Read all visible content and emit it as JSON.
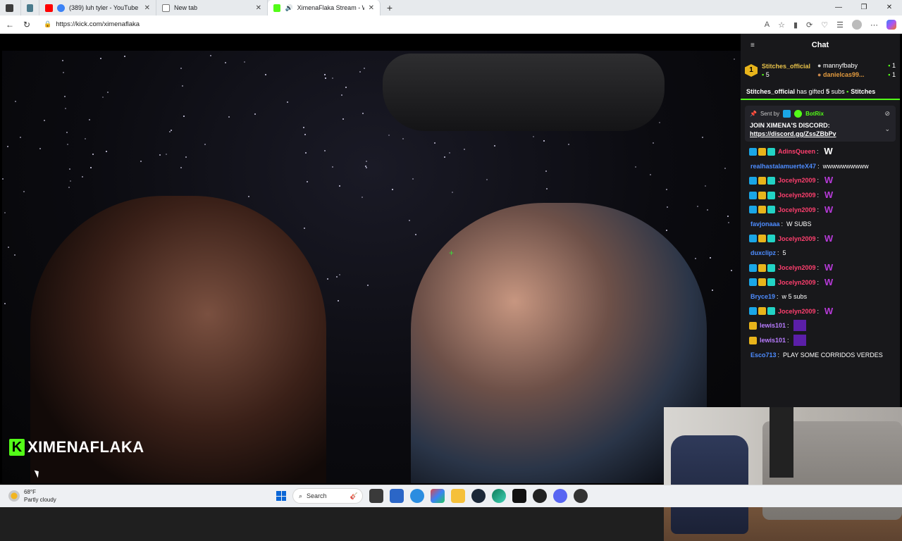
{
  "browser": {
    "tabs": [
      {
        "title": "",
        "favicon": "sidebar-icon"
      },
      {
        "title": "",
        "favicon": "page-icon"
      },
      {
        "title": "(389) luh tyler - YouTube",
        "favicon": "youtube-icon"
      },
      {
        "title": "New tab",
        "favicon": "newtab-icon"
      },
      {
        "title": "XimenaFlaka Stream - Watch",
        "favicon": "kick-icon"
      }
    ],
    "new_tab_label": "+",
    "url": "https://kick.com/ximenaflaka"
  },
  "video": {
    "channel_logo_letter": "K",
    "channel_name": "XIMENAFLAKA"
  },
  "chat": {
    "title": "Chat",
    "leaderboard": {
      "first": {
        "rank": "1",
        "name": "Stitches_official",
        "count": "5"
      },
      "second": {
        "name": "mannyfbaby",
        "count": "1"
      },
      "third": {
        "name": "danielcas99...",
        "count": "1"
      }
    },
    "gift_banner": {
      "user": "Stitches_official",
      "text_mid": " has gifted ",
      "count": "5",
      "text_end": " subs ",
      "trailing": "Stitches"
    },
    "pinned": {
      "sent_by_label": "Sent by",
      "sender": "BotRix",
      "message": "JOIN XIMENA'S DISCORD:",
      "link": "https://discord.gg/ZssZBbPv"
    },
    "messages": [
      {
        "user": "AdinsQueen",
        "color": "#ff3f6e",
        "badges": 3,
        "text": "",
        "emote": "W"
      },
      {
        "user": "realhastalamuerteX47",
        "color": "#4d8cff",
        "badges": 0,
        "text": "wwwwwwwwww",
        "emote": ""
      },
      {
        "user": "Jocelyn2009",
        "color": "#ff3f6e",
        "badges": 3,
        "text": "",
        "emote": "W"
      },
      {
        "user": "Jocelyn2009",
        "color": "#ff3f6e",
        "badges": 3,
        "text": "",
        "emote": "W"
      },
      {
        "user": "Jocelyn2009",
        "color": "#ff3f6e",
        "badges": 3,
        "text": "",
        "emote": "W"
      },
      {
        "user": "favjonaaa",
        "color": "#4d8cff",
        "badges": 0,
        "text": "W SUBS",
        "emote": ""
      },
      {
        "user": "Jocelyn2009",
        "color": "#ff3f6e",
        "badges": 3,
        "text": "",
        "emote": "W"
      },
      {
        "user": "duxclipz",
        "color": "#4d8cff",
        "badges": 0,
        "text": "5",
        "emote": ""
      },
      {
        "user": "Jocelyn2009",
        "color": "#ff3f6e",
        "badges": 3,
        "text": "",
        "emote": "W"
      },
      {
        "user": "Jocelyn2009",
        "color": "#ff3f6e",
        "badges": 3,
        "text": "",
        "emote": "W"
      },
      {
        "user": "Bryce19",
        "color": "#4d8cff",
        "badges": 0,
        "text": "w 5 subs",
        "emote": ""
      },
      {
        "user": "Jocelyn2009",
        "color": "#ff3f6e",
        "badges": 3,
        "text": "",
        "emote": "W"
      },
      {
        "user": "lewis101",
        "color": "#b87cff",
        "badges": 1,
        "text": "",
        "emote": "block"
      },
      {
        "user": "lewis101",
        "color": "#b87cff",
        "badges": 1,
        "text": "",
        "emote": "block"
      },
      {
        "user": "Esco713",
        "color": "#4d8cff",
        "badges": 0,
        "text": "PLAY SOME CORRIDOS VERDES",
        "emote": ""
      }
    ]
  },
  "taskbar": {
    "temperature": "68°F",
    "condition": "Partly cloudy",
    "search_placeholder": "Search"
  }
}
